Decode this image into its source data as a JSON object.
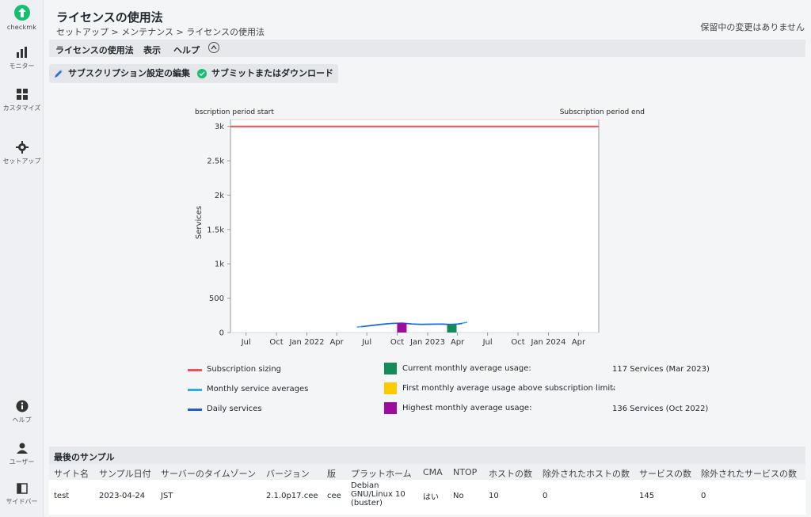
{
  "app": {
    "logo_text": "checkmk"
  },
  "sidebar": {
    "items": [
      {
        "label": "モニター"
      },
      {
        "label": "カスタマイズ"
      },
      {
        "label": "セットアップ"
      },
      {
        "label": "ヘルプ"
      },
      {
        "label": "ユーザー"
      },
      {
        "label": "サイドバー"
      }
    ]
  },
  "header": {
    "title": "ライセンスの使用法",
    "breadcrumb": "セットアップ > メンテナンス > ライセンスの使用法",
    "pending": "保留中の変更はありません"
  },
  "menu": {
    "items": [
      {
        "label": "ライセンスの使用法"
      },
      {
        "label": "表示"
      },
      {
        "label": "ヘルプ"
      }
    ]
  },
  "toolbar": {
    "edit_label": "サブスクリプション設定の編集",
    "submit_label": "サブミットまたはダウンロード"
  },
  "chart_data": {
    "type": "line",
    "annotations": {
      "start": "bscription period start",
      "end": "Subscription period end"
    },
    "ylabel": "Services",
    "ylim": [
      0,
      3100
    ],
    "yticks": [
      {
        "v": 0,
        "label": "0"
      },
      {
        "v": 500,
        "label": "500"
      },
      {
        "v": 1000,
        "label": "1k"
      },
      {
        "v": 1500,
        "label": "1.5k"
      },
      {
        "v": 2000,
        "label": "2k"
      },
      {
        "v": 2500,
        "label": "2.5k"
      },
      {
        "v": 3000,
        "label": "3k"
      }
    ],
    "xlim": [
      "2021-05-15",
      "2024-06-01"
    ],
    "xticks": [
      {
        "d": "2021-07-01",
        "label": "Jul"
      },
      {
        "d": "2021-10-01",
        "label": "Oct"
      },
      {
        "d": "2022-01-01",
        "label": "Jan 2022"
      },
      {
        "d": "2022-04-01",
        "label": "Apr"
      },
      {
        "d": "2022-07-01",
        "label": "Jul"
      },
      {
        "d": "2022-10-01",
        "label": "Oct"
      },
      {
        "d": "2023-01-01",
        "label": "Jan 2023"
      },
      {
        "d": "2023-04-01",
        "label": "Apr"
      },
      {
        "d": "2023-07-01",
        "label": "Jul"
      },
      {
        "d": "2023-10-01",
        "label": "Oct"
      },
      {
        "d": "2024-01-01",
        "label": "Jan 2024"
      },
      {
        "d": "2024-04-01",
        "label": "Apr"
      }
    ],
    "series": [
      {
        "name": "Subscription sizing",
        "color": "#f05252",
        "x": [
          "2021-05-15",
          "2024-06-01"
        ],
        "y": [
          3000,
          3000
        ]
      },
      {
        "name": "Monthly service averages",
        "color": "#2eaaf5",
        "x": [
          "2022-06-01",
          "2022-07-01",
          "2022-08-01",
          "2022-09-01",
          "2022-10-01",
          "2022-11-01",
          "2022-12-01",
          "2023-01-01",
          "2023-02-01",
          "2023-03-01",
          "2023-04-01",
          "2023-05-01"
        ],
        "y": [
          80,
          95,
          115,
          130,
          136,
          128,
          120,
          122,
          124,
          117,
          125,
          150
        ]
      },
      {
        "name": "Daily services",
        "color": "#1f5fd6",
        "x": [
          "2022-06-15",
          "2022-07-15",
          "2022-08-15",
          "2022-09-15",
          "2022-10-15",
          "2022-11-15",
          "2022-12-15",
          "2023-01-15",
          "2023-02-15",
          "2023-03-15",
          "2023-04-15"
        ],
        "y": [
          85,
          100,
          118,
          132,
          138,
          126,
          119,
          121,
          125,
          116,
          130
        ]
      }
    ],
    "markers": [
      {
        "name": "Current monthly average usage:",
        "color": "#158a5b",
        "d": "2023-03-15",
        "y": 117,
        "value": "117 Services (Mar 2023)"
      },
      {
        "name": "First monthly average usage above subscription limit:",
        "color": "#fdcb00",
        "value": "-"
      },
      {
        "name": "Highest monthly average usage:",
        "color": "#9b0c9f",
        "d": "2022-10-15",
        "y": 136,
        "value": "136 Services (Oct 2022)"
      }
    ]
  },
  "table": {
    "title": "最後のサンプル",
    "headers": [
      "サイト名",
      "サンプル日付",
      "サーバーのタイムゾーン",
      "バージョン",
      "版",
      "プラットホーム",
      "CMA",
      "NTOP",
      "ホストの数",
      "除外されたホストの数",
      "サービスの数",
      "除外されたサービスの数"
    ],
    "rows": [
      [
        "test",
        "2023-04-24",
        "JST",
        "2.1.0p17.cee",
        "cee",
        "Debian GNU/Linux 10 (buster)",
        "はい",
        "No",
        "10",
        "0",
        "145",
        "0"
      ]
    ]
  }
}
